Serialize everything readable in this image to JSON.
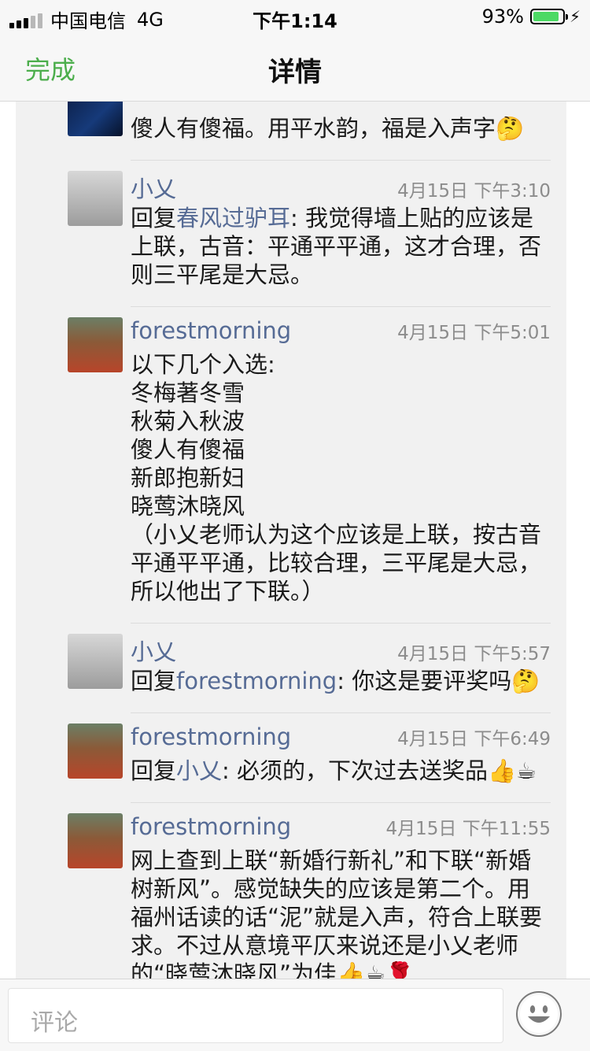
{
  "status_bar": {
    "carrier": "中国电信",
    "network": "4G",
    "time": "下午1:14",
    "battery": "93%"
  },
  "nav": {
    "done": "完成",
    "title": "详情"
  },
  "comments": [
    {
      "text": "傻人有傻福。用平水韵，福是入声字🤔"
    },
    {
      "name": "小乂",
      "time": "4月15日 下午3:10",
      "reply_prefix": "回复",
      "reply_to": "春风过驴耳",
      "text": ": 我觉得墙上贴的应该是上联，古音：平通平平通，这才合理，否则三平尾是大忌。"
    },
    {
      "name": "forestmorning",
      "time": "4月15日 下午5:01",
      "lines": [
        "以下几个入选:",
        "冬梅著冬雪",
        "秋菊入秋波",
        "傻人有傻福",
        "新郎抱新妇",
        "晓莺沐晓风",
        "（小乂老师认为这个应该是上联，按古音平通平平通，比较合理，三平尾是大忌，所以他出了下联。）"
      ]
    },
    {
      "name": "小乂",
      "time": "4月15日 下午5:57",
      "reply_prefix": "回复",
      "reply_to": "forestmorning",
      "text": ": 你这是要评奖吗🤔"
    },
    {
      "name": "forestmorning",
      "time": "4月15日 下午6:49",
      "reply_prefix": "回复",
      "reply_to": "小乂",
      "text": ": 必须的，下次过去送奖品👍☕"
    },
    {
      "name": "forestmorning",
      "time": "4月15日 下午11:55",
      "text": "网上查到上联“新婚行新礼”和下联“新婚树新风”。感觉缺失的应该是第二个。用福州话读的话“泥”就是入声，符合上联要求。不过从意境平仄来说还是小乂老师的“晓莺沐晓风”为佳👍☕🌹"
    }
  ],
  "input": {
    "placeholder": "评论"
  },
  "colors": {
    "accent_green": "#4cae4c",
    "link_blue": "#566b95",
    "battery_green": "#4cd964"
  },
  "icons": {
    "emoji_button": "smiley-face-icon"
  }
}
